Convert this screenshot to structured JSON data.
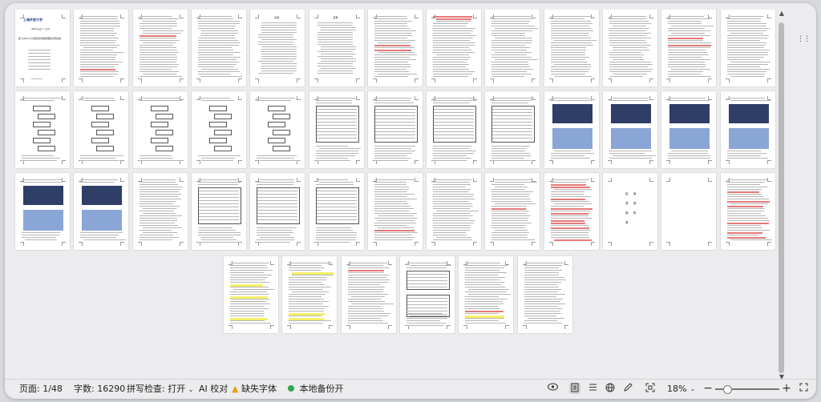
{
  "status": {
    "page": "页面: 1/48",
    "word_count": "字数: 16290",
    "spellcheck": "拼写检查: 打开",
    "ai_proofread": "AI 校对",
    "missing_fonts": "缺失字体",
    "local_backup": "本地备份开",
    "zoom": "18%",
    "zoom_level_percent": 18
  },
  "pages": {
    "cover": {
      "university": "上海开放大学",
      "subtitle": "本科毕业设计（论文）",
      "title": "基于python与大模型的智能校园图文问答系统"
    },
    "toc": {
      "title": "目录"
    },
    "ending": {
      "chars": [
        "结",
        "束",
        "语",
        "致",
        "谢",
        "附",
        "录"
      ]
    }
  },
  "colors": {
    "highlight": "#f4f06a",
    "accent_red": "#d94040",
    "backup_green": "#2fa84f",
    "warning": "#e3a31b"
  },
  "icons": {
    "more": "more-icon",
    "view": "eye-icon",
    "layout": "page-layout-icon",
    "list": "outline-icon",
    "web": "web-layout-icon",
    "edit": "pen-icon",
    "fit": "fit-page-icon",
    "zoom_out": "minus-icon",
    "zoom_in": "plus-icon",
    "fullscreen": "fullscreen-icon"
  }
}
